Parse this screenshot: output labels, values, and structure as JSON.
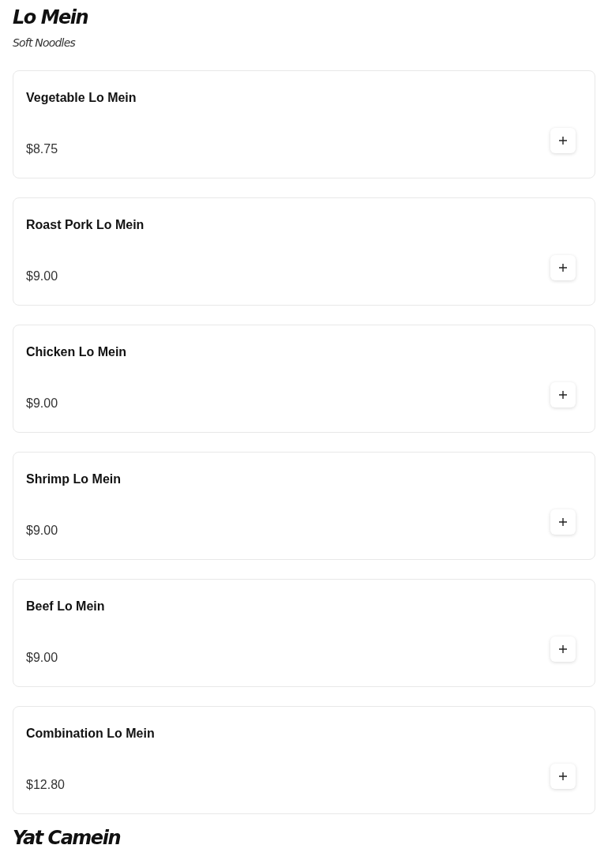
{
  "sections": [
    {
      "title": "Lo Mein",
      "subtitle": "Soft Noodles",
      "items": [
        {
          "name": "Vegetable Lo Mein",
          "price": "$8.75"
        },
        {
          "name": "Roast Pork Lo Mein",
          "price": "$9.00"
        },
        {
          "name": "Chicken Lo Mein",
          "price": "$9.00"
        },
        {
          "name": "Shrimp Lo Mein",
          "price": "$9.00"
        },
        {
          "name": "Beef Lo Mein",
          "price": "$9.00"
        },
        {
          "name": "Combination Lo Mein",
          "price": "$12.80"
        }
      ]
    },
    {
      "title": "Yat Camein"
    }
  ]
}
